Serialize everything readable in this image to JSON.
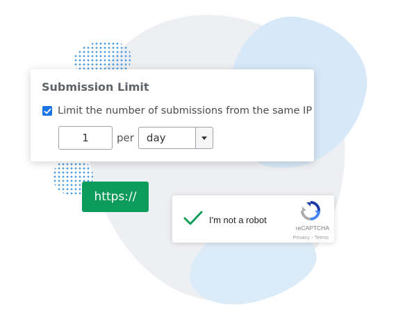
{
  "submission_limit": {
    "title": "Submission Limit",
    "checkbox_label": "Limit the number of submissions from the same IP",
    "checkbox_checked": true,
    "count_value": "1",
    "per_label": "per",
    "period_selected": "day"
  },
  "https_button": {
    "label": "https://"
  },
  "recaptcha": {
    "label": "I'm not a robot",
    "brand": "reCAPTCHA",
    "links": "Privacy - Terms"
  },
  "colors": {
    "checkbox_blue": "#1a73e8",
    "https_green": "#0d9b5c",
    "check_green": "#0f9d58"
  }
}
